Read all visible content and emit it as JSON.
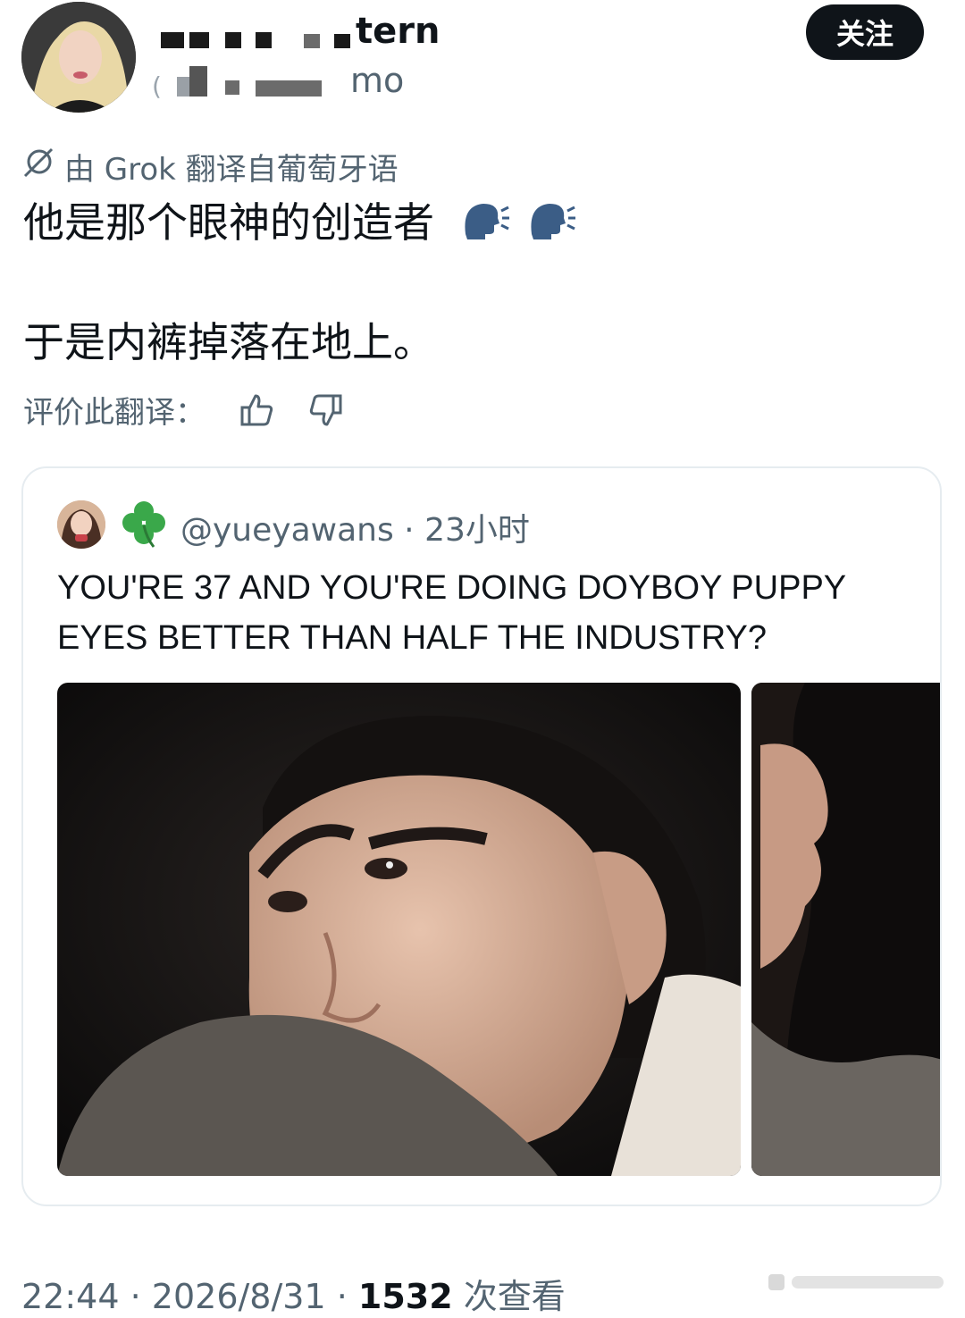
{
  "header": {
    "name_suffix": "tern",
    "handle_suffix": "mo",
    "handle_prefix": "(",
    "follow_label": "关注"
  },
  "post": {
    "translation_note": "由 Grok 翻译自葡萄牙语",
    "line1": "他是那个眼神的创造者",
    "line1_icons": [
      "speaking-head-icon",
      "speaking-head-icon"
    ],
    "line2": "于是内裤掉落在地上。",
    "rate_label": "评价此翻译："
  },
  "quote": {
    "badge_icon": "four-leaf-clover-icon",
    "handle": "@yueyawans",
    "separator": "·",
    "time": "23小时",
    "text": "YOU'RE 37 AND YOU'RE DOING DOYBOY PUPPY EYES BETTER THAN HALF THE INDUSTRY?"
  },
  "footer": {
    "time": "22:44",
    "sep1": "·",
    "date": "2026/8/31",
    "sep2": "·",
    "views": "1532",
    "views_label": "次查看"
  },
  "colors": {
    "text": "#0f1419",
    "secondary": "#536471",
    "border": "#e6ecf0",
    "button_bg": "#0f1419",
    "clover": "#3aa84a"
  }
}
